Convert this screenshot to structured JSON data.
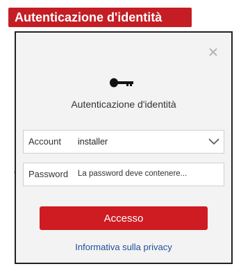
{
  "banner": {
    "title": "Autenticazione d'identità"
  },
  "stray_text": "a",
  "dialog": {
    "heading": "Autenticazione d'identità",
    "close_icon": "close-x",
    "key_icon": "key",
    "account": {
      "label": "Account",
      "value": "installer",
      "dropdown_icon": "chevron-down"
    },
    "password": {
      "label": "Password",
      "placeholder": "La password deve contenere..."
    },
    "login_label": "Accesso",
    "privacy_label": "Informativa sulla privacy"
  },
  "colors": {
    "brand_red": "#cf1b22",
    "banner_red": "#c41e24",
    "link_blue": "#1f4f99",
    "dialog_bg": "#f3f3f3"
  }
}
